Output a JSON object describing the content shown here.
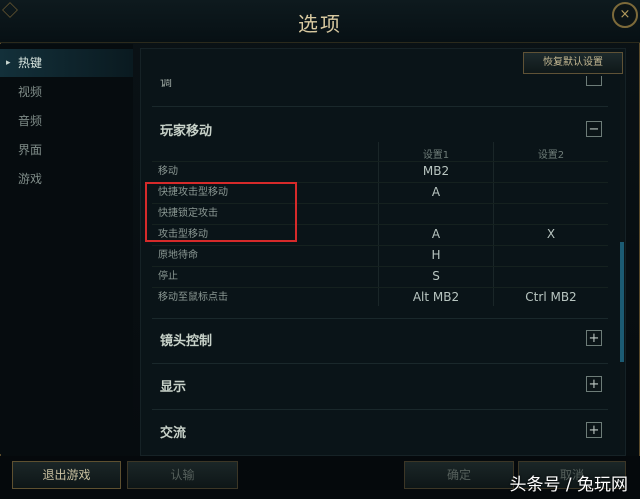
{
  "window": {
    "title": "选项",
    "close_glyph": "×"
  },
  "sidebar": {
    "items": [
      {
        "label": "热键",
        "active": true
      },
      {
        "label": "视频"
      },
      {
        "label": "音频"
      },
      {
        "label": "界面"
      },
      {
        "label": "游戏"
      }
    ]
  },
  "restore_defaults": "恢复默认设置",
  "sections": {
    "partial_above": "调",
    "player_movement": {
      "title": "玩家移动",
      "toggle": "−",
      "col1": "设置1",
      "col2": "设置2",
      "rows": [
        {
          "name": "移动",
          "k1": "MB2",
          "k2": ""
        },
        {
          "name": "快捷攻击型移动",
          "k1": "A",
          "k2": ""
        },
        {
          "name": "快捷锁定攻击",
          "k1": "",
          "k2": ""
        },
        {
          "name": "攻击型移动",
          "k1": "A",
          "k2": "X"
        },
        {
          "name": "原地待命",
          "k1": "H",
          "k2": ""
        },
        {
          "name": "停止",
          "k1": "S",
          "k2": ""
        },
        {
          "name": "移动至鼠标点击",
          "k1": "Alt MB2",
          "k2": "Ctrl MB2"
        }
      ]
    },
    "camera": {
      "title": "镜头控制",
      "toggle": "+"
    },
    "display": {
      "title": "显示",
      "toggle": "+"
    },
    "communication": {
      "title": "交流",
      "toggle": "+"
    }
  },
  "footer": {
    "exit_game": "退出游戏",
    "confirm_dim": "认输",
    "ok": "确定",
    "cancel": "取消"
  },
  "watermark": "头条号 / 兔玩网",
  "colors": {
    "highlight_box": "#d62a2a",
    "scroll_thumb": "#1c5b73"
  }
}
